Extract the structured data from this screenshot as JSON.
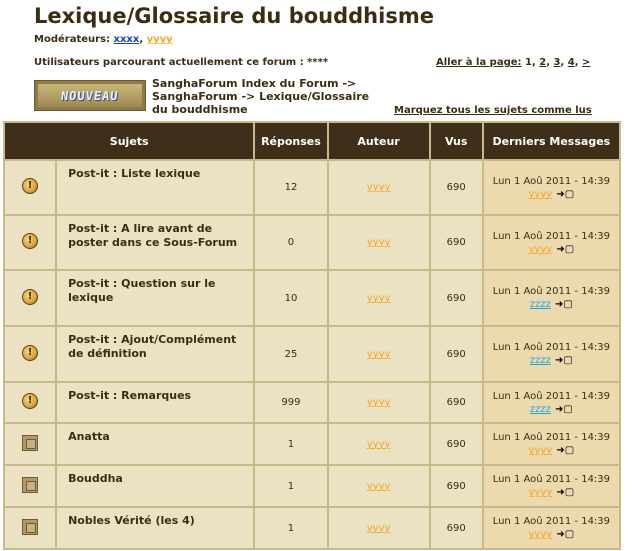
{
  "page": {
    "title": "Lexique/Glossaire du bouddhisme",
    "moderators_label": "Modérateurs:",
    "moderators": [
      "xxxx",
      "yyyy"
    ],
    "users_browsing": "Utilisateurs parcourant actuellement ce forum : ****",
    "goto_page_label": "Aller à la page:",
    "pages": [
      "1",
      "2",
      "3",
      "4",
      ">"
    ],
    "new_button_label": "NOUVEAU",
    "breadcrumb": [
      "SanghaForum Index du Forum ->",
      "SanghaForum -> Lexique/Glossaire",
      "du bouddhisme"
    ],
    "mark_all_read": "Marquez tous les sujets comme lus"
  },
  "table": {
    "headers": {
      "subjects": "Sujets",
      "replies": "Réponses",
      "author": "Auteur",
      "views": "Vus",
      "last": "Derniers Messages"
    },
    "rows": [
      {
        "icon": "sticky-icon",
        "subject": "Post-it : Liste lexique",
        "replies": "12",
        "author": "yyyy",
        "views": "690",
        "last_date": "Lun 1 Aoû 2011 - 14:39",
        "last_user": "yyyy",
        "last_user_color": "#f5a623"
      },
      {
        "icon": "sticky-icon",
        "subject": "Post-it : A lire avant de poster dans ce Sous-Forum",
        "replies": "0",
        "author": "yyyy",
        "views": "690",
        "last_date": "Lun 1 Aoû 2011 - 14:39",
        "last_user": "yyyy",
        "last_user_color": "#f5a623"
      },
      {
        "icon": "sticky-icon",
        "subject": "Post-it : Question sur le lexique",
        "replies": "10",
        "author": "yyyy",
        "views": "690",
        "last_date": "Lun 1 Aoû 2011 - 14:39",
        "last_user": "zzzz",
        "last_user_color": "#1ea5e8"
      },
      {
        "icon": "sticky-icon",
        "subject": "Post-it : Ajout/Complément de définition",
        "replies": "25",
        "author": "yyyy",
        "views": "690",
        "last_date": "Lun 1 Aoû 2011 - 14:39",
        "last_user": "zzzz",
        "last_user_color": "#1ea5e8"
      },
      {
        "icon": "sticky-icon",
        "subject": "Post-it : Remarques",
        "replies": "999",
        "author": "yyyy",
        "views": "690",
        "last_date": "Lun 1 Aoû 2011 - 14:39",
        "last_user": "zzzz",
        "last_user_color": "#1ea5e8"
      },
      {
        "icon": "folder-icon",
        "subject": "Anatta",
        "replies": "1",
        "author": "yyyy",
        "views": "690",
        "last_date": "Lun 1 Aoû 2011 - 14:39",
        "last_user": "yyyy",
        "last_user_color": "#f5a623"
      },
      {
        "icon": "folder-icon",
        "subject": "Bouddha",
        "replies": "1",
        "author": "yyyy",
        "views": "690",
        "last_date": "Lun 1 Aoû 2011 - 14:39",
        "last_user": "yyyy",
        "last_user_color": "#f5a623"
      },
      {
        "icon": "folder-icon",
        "subject": "Nobles Vérité (les 4)",
        "replies": "1",
        "author": "yyyy",
        "views": "690",
        "last_date": "Lun 1 Aoû 2011 - 14:39",
        "last_user": "yyyy",
        "last_user_color": "#f5a623"
      }
    ]
  }
}
